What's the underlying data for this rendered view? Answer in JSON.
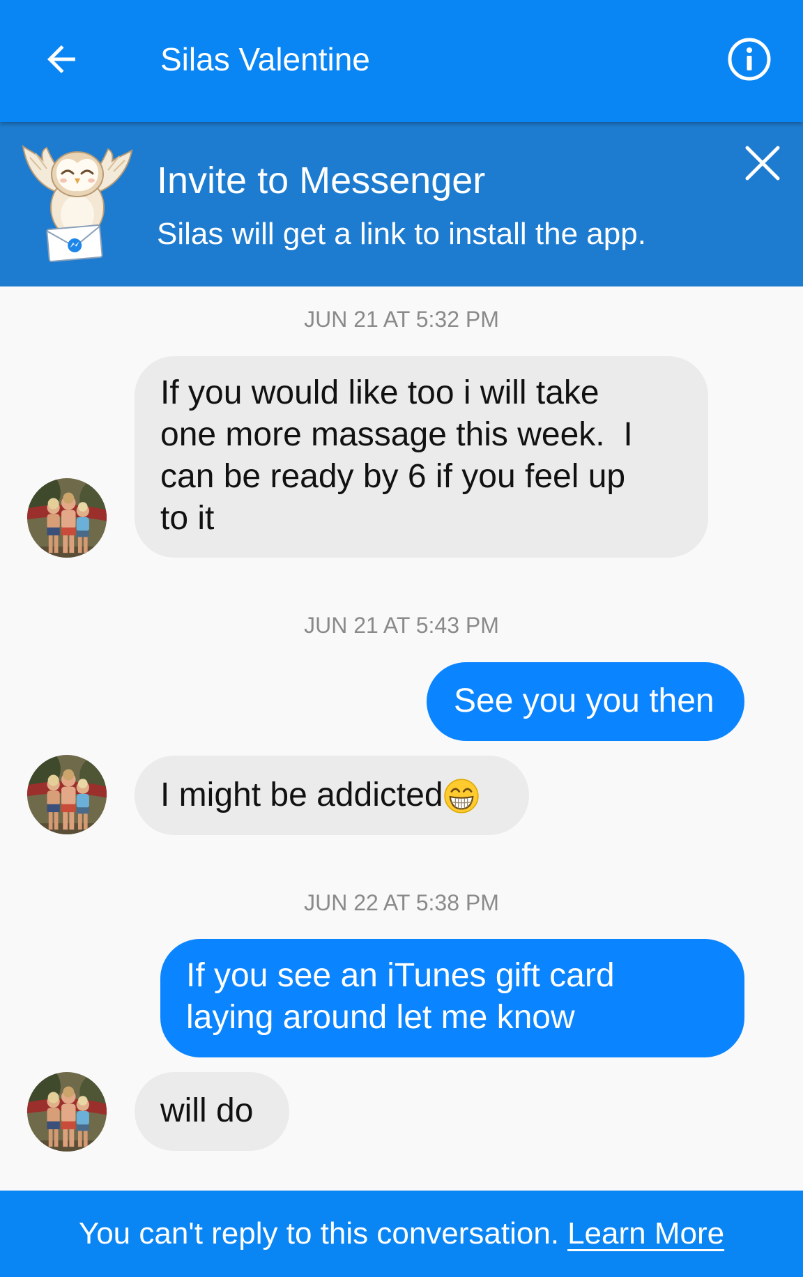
{
  "header": {
    "title": "Silas Valentine",
    "back_icon": "back-arrow-icon",
    "info_icon": "info-icon"
  },
  "invite_banner": {
    "title": "Invite to Messenger",
    "subtitle": "Silas will get a link to install the app.",
    "illustration_icon": "owl-with-envelope-icon",
    "close_icon": "close-icon"
  },
  "timestamps": [
    "JUN 21 AT 5:32 PM",
    "JUN 21 AT 5:43 PM",
    "JUN 22 AT 5:38 PM"
  ],
  "messages": [
    {
      "from_me": false,
      "lines": [
        "If you would like too i will take",
        "one more massage this week.  I",
        "can be ready by 6 if you feel up",
        "to it"
      ]
    },
    {
      "from_me": true,
      "lines": [
        "See you you then"
      ]
    },
    {
      "from_me": false,
      "lines": [
        "I might be addicted"
      ],
      "emoji_icon": "grinning-face-with-smiling-eyes-icon"
    },
    {
      "from_me": true,
      "lines": [
        "If you see an iTunes gift card",
        "laying around let me know"
      ]
    },
    {
      "from_me": false,
      "lines": [
        "will do"
      ]
    }
  ],
  "footer": {
    "notice": "You can't reply to this conversation.",
    "link": "Learn More"
  },
  "colors": {
    "header": "#0a85f4",
    "banner": "#1e7cd0",
    "sent_bubble": "#0a84ff",
    "received_bubble": "#ebebeb",
    "background": "#f9f9f9",
    "timestamp_text": "#8a8a8a"
  }
}
